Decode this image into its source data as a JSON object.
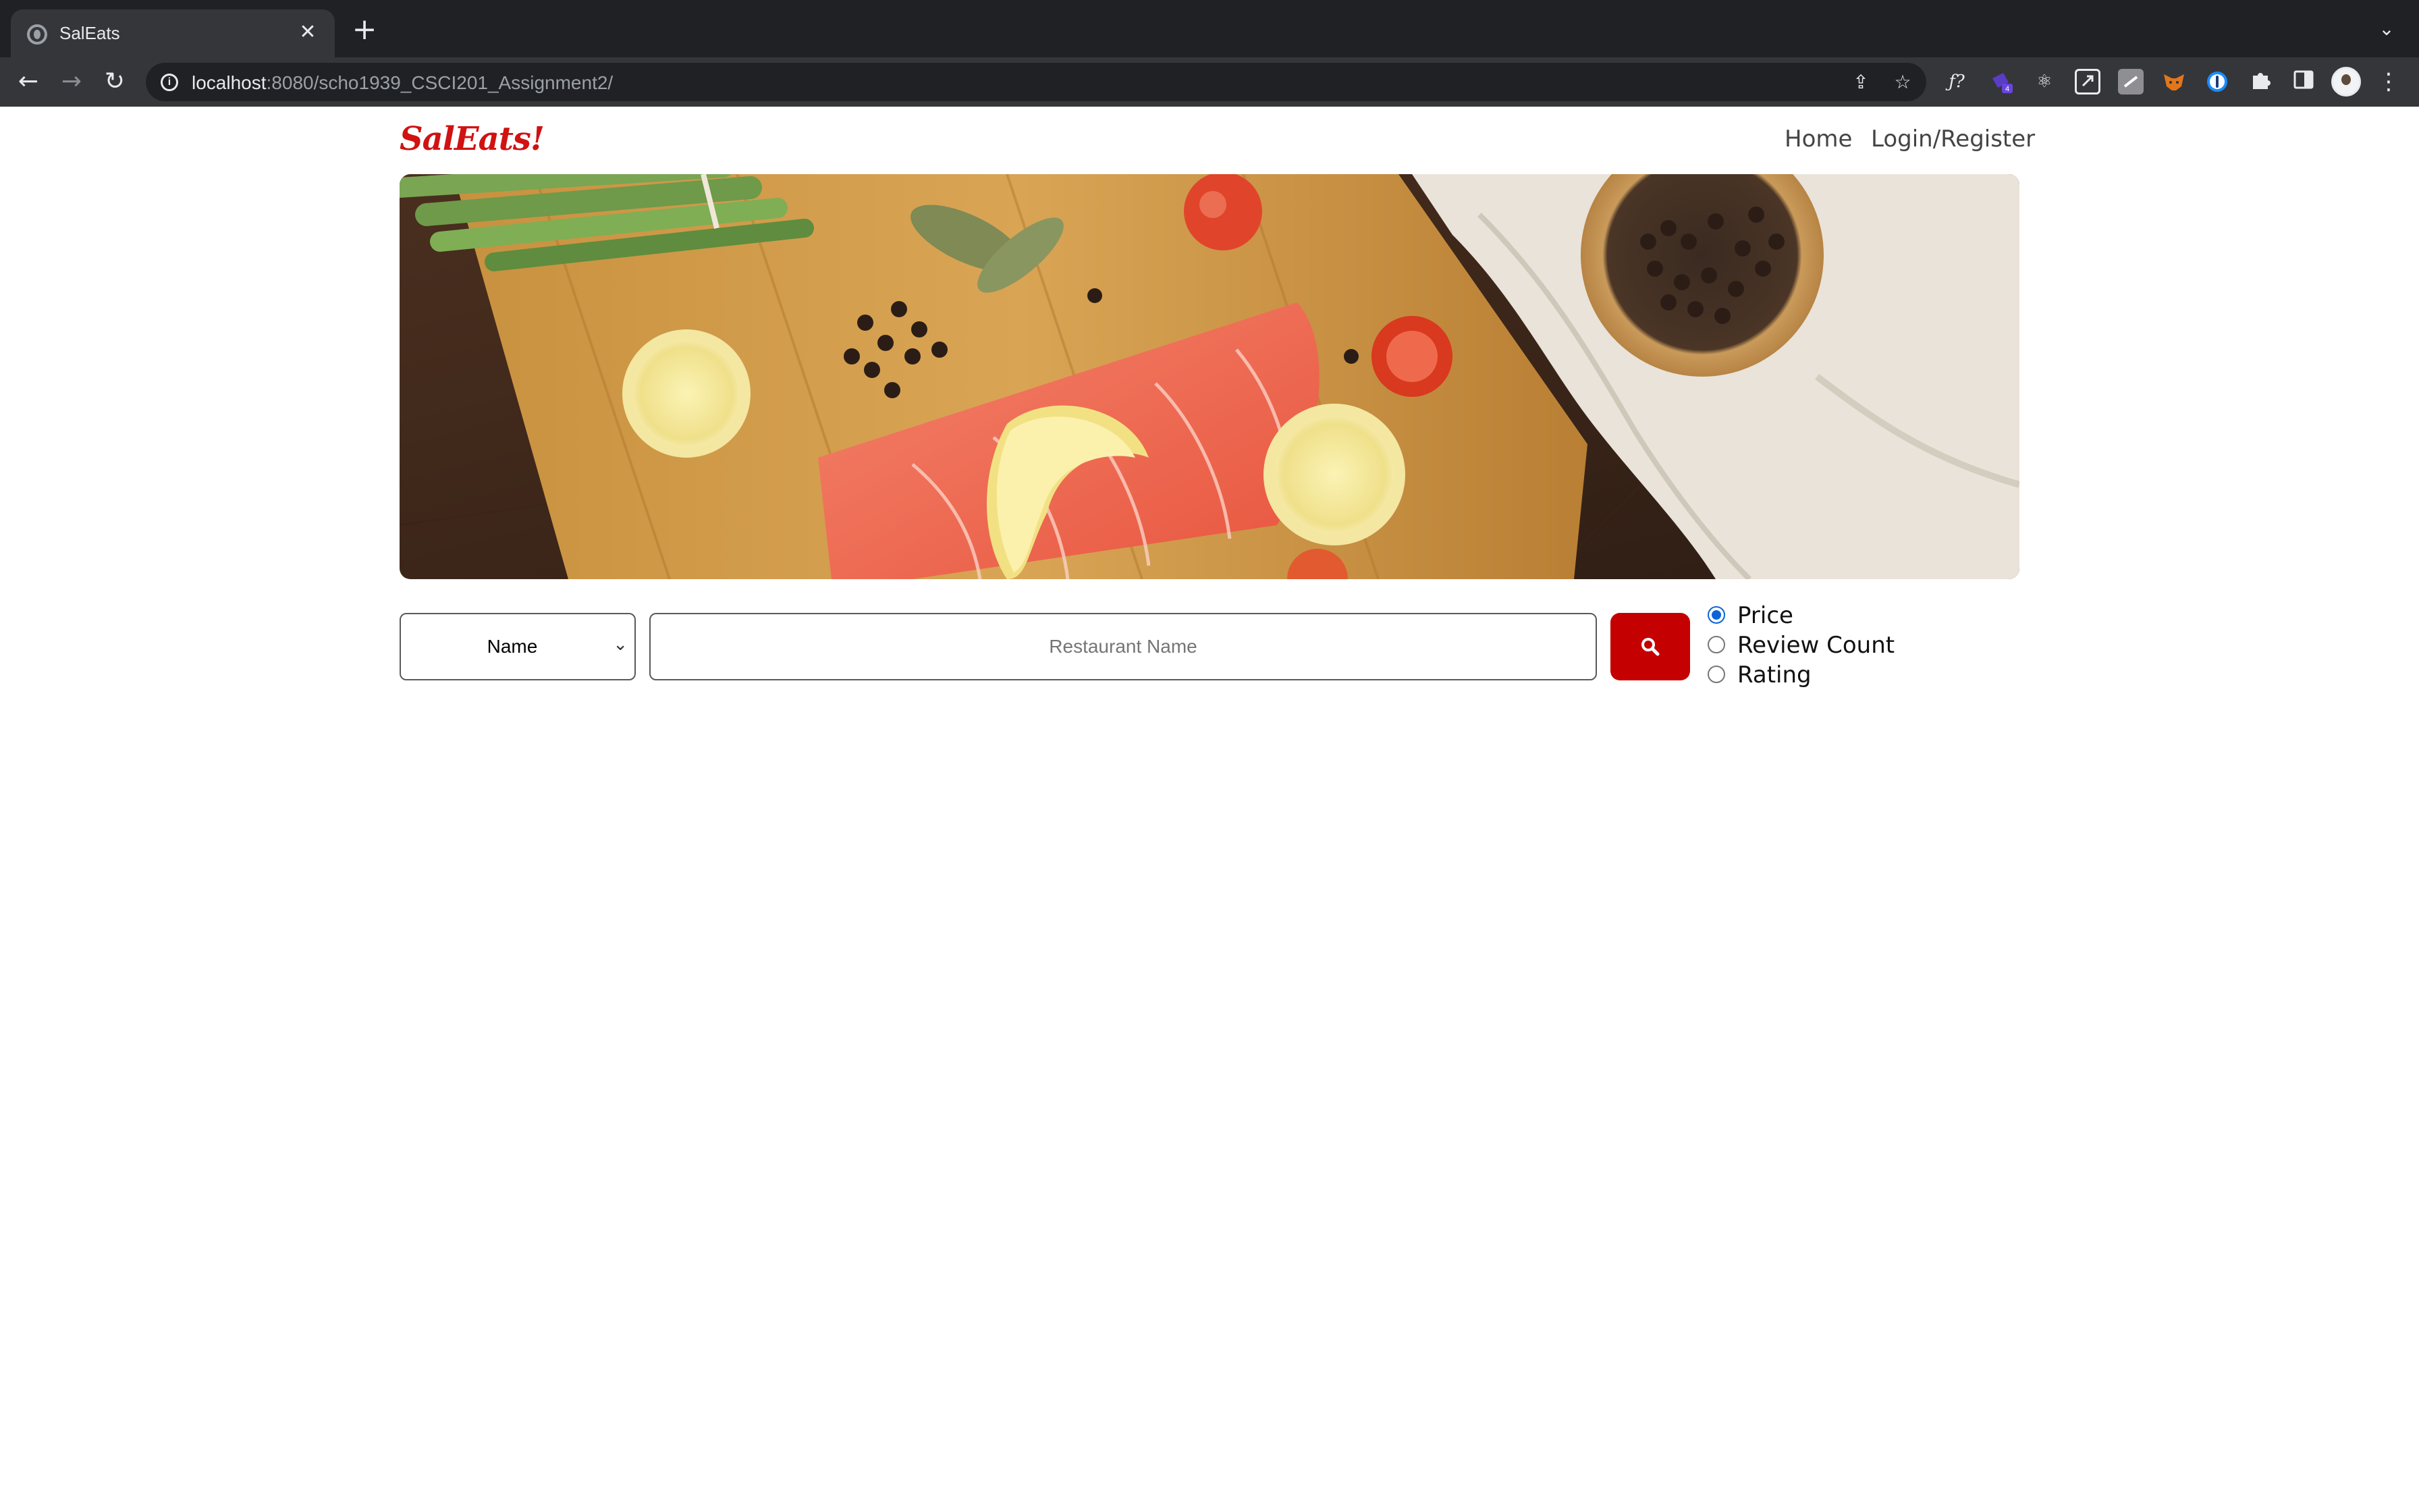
{
  "browser": {
    "tab_title": "SalEats",
    "url_host": "localhost",
    "url_rest": ":8080/scho1939_CSCI201_Assignment2/",
    "extensions": [
      "formula-icon",
      "extension-badge-icon",
      "react-icon",
      "resize-icon",
      "stripe-icon",
      "metamask-icon",
      "onepassword-icon",
      "puzzle-icon",
      "sidebar-icon"
    ],
    "extension_badge_count": "4"
  },
  "header": {
    "logo": "SalEats!",
    "nav": {
      "home": "Home",
      "login": "Login/Register"
    }
  },
  "search": {
    "type_selected": "Name",
    "placeholder": "Restaurant Name",
    "button_color": "#c50000"
  },
  "sort_options": [
    {
      "label": "Price",
      "checked": true
    },
    {
      "label": "Review Count",
      "checked": false
    },
    {
      "label": "Rating",
      "checked": false
    }
  ],
  "colors": {
    "brand": "#d11212",
    "radio_accent": "#0b64d8"
  }
}
